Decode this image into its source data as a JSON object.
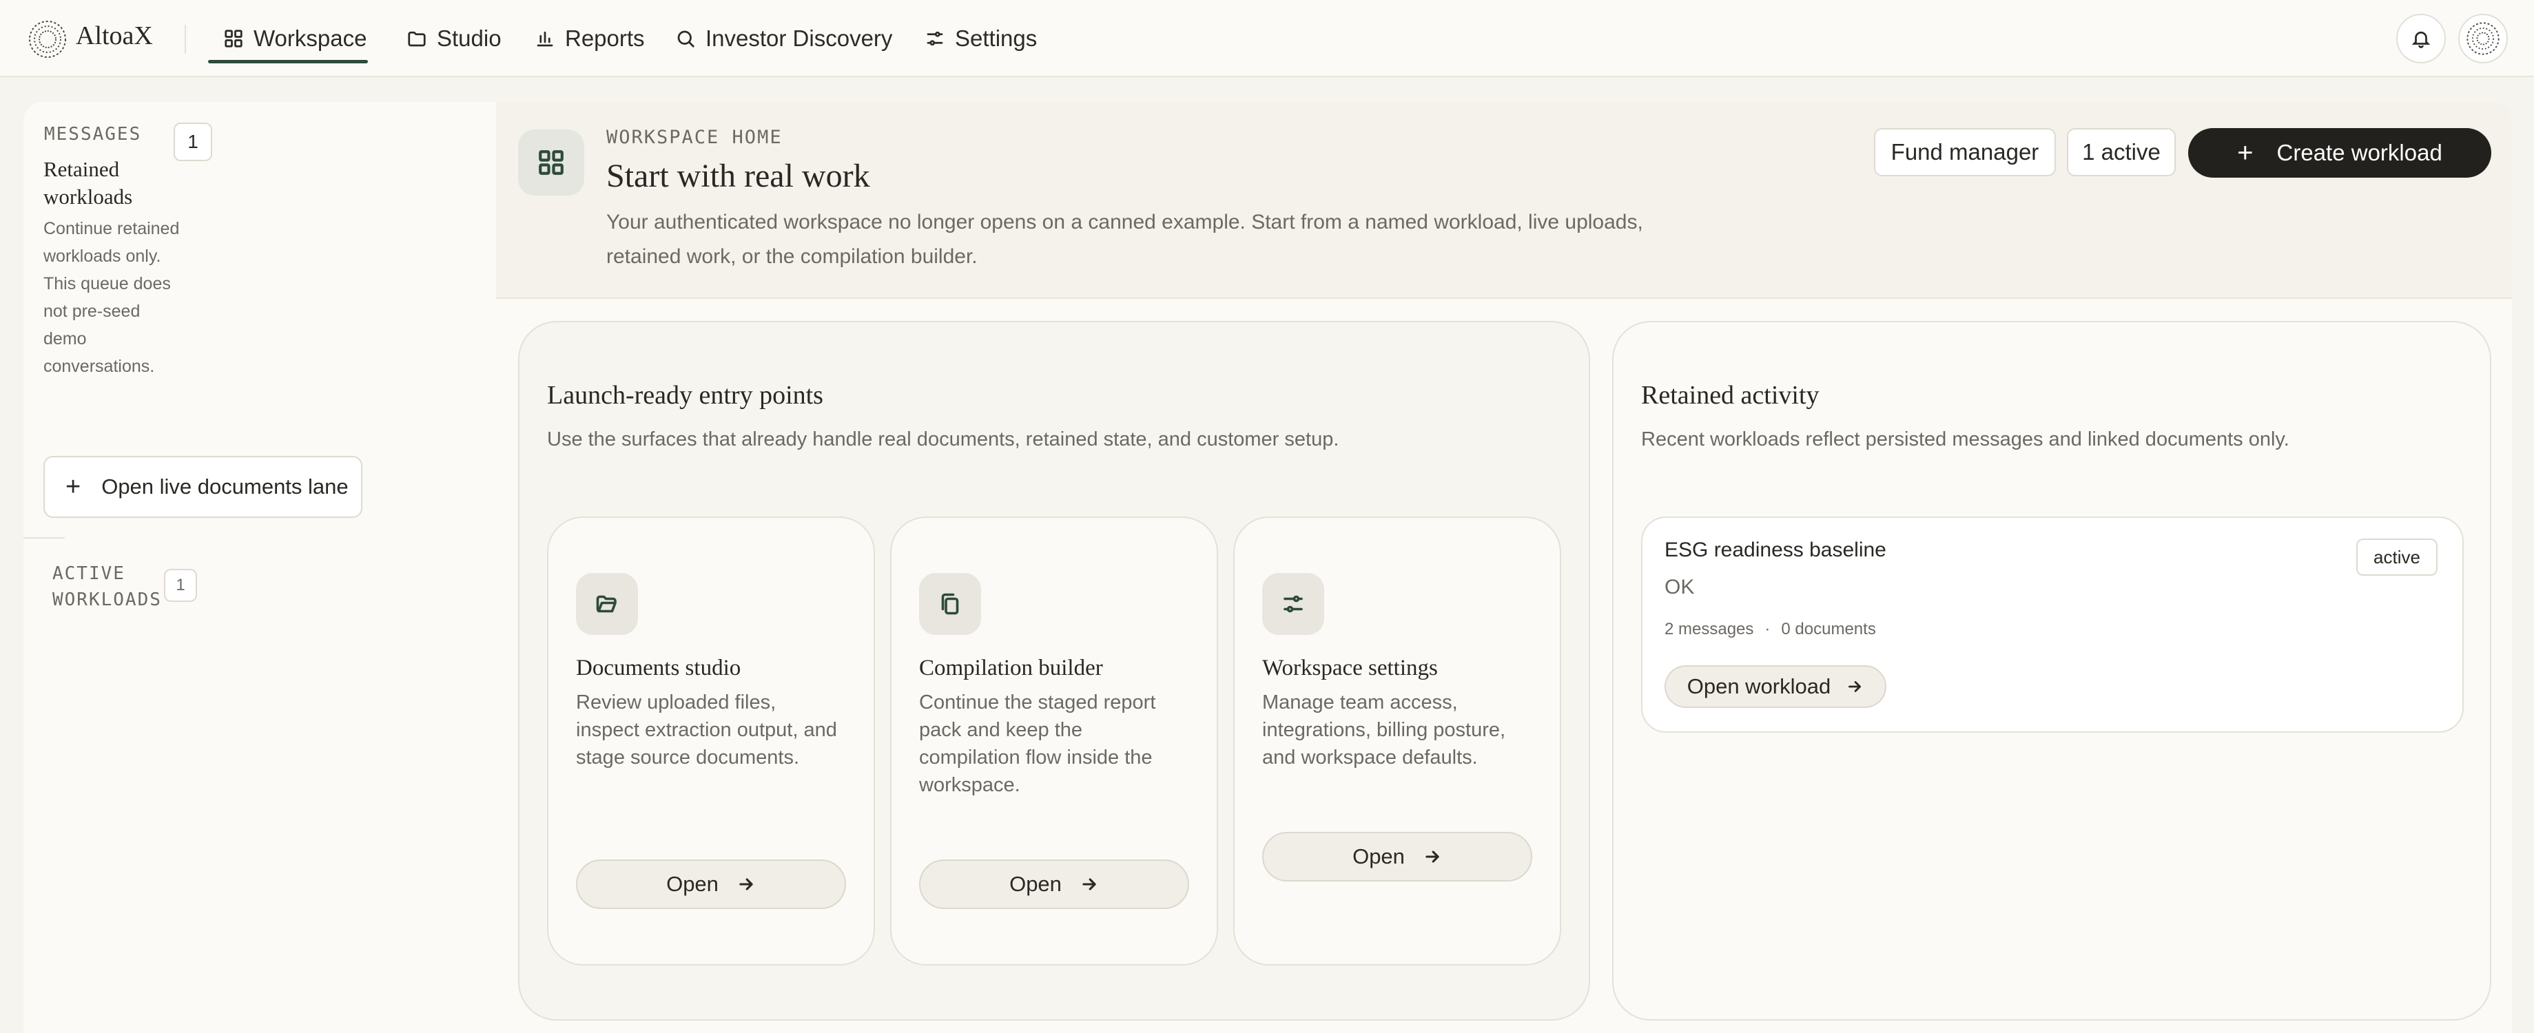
{
  "app": {
    "brand": "AltoaX"
  },
  "nav": [
    {
      "label": "Workspace",
      "icon": "grid-icon",
      "active": true
    },
    {
      "label": "Studio",
      "icon": "folder-icon"
    },
    {
      "label": "Reports",
      "icon": "bar-chart-icon"
    },
    {
      "label": "Investor Discovery",
      "icon": "search-icon"
    },
    {
      "label": "Settings",
      "icon": "sliders-icon"
    }
  ],
  "sidebar": {
    "messages_heading": "MESSAGES",
    "messages_count": "1",
    "section_title": "Retained workloads",
    "section_desc": "Continue retained workloads only. This queue does not pre-seed demo conversations.",
    "open_button": "Open live documents lane",
    "active_heading": "ACTIVE WORKLOADS",
    "active_count": "1"
  },
  "hero": {
    "eyebrow": "WORKSPACE HOME",
    "title": "Start with real work",
    "description": "Your authenticated workspace no longer opens on a canned example. Start from a named workload, live uploads, retained work, or the compilation builder.",
    "role_chip": "Fund manager",
    "active_chip": "1 active",
    "create_button": "Create workload"
  },
  "entry_points": {
    "title": "Launch-ready entry points",
    "description": "Use the surfaces that already handle real documents, retained state, and customer setup.",
    "cards": [
      {
        "title": "Documents studio",
        "description": "Review uploaded files, inspect extraction output, and stage source documents.",
        "button": "Open",
        "icon": "folder-open-icon"
      },
      {
        "title": "Compilation builder",
        "description": "Continue the staged report pack and keep the compilation flow inside the workspace.",
        "button": "Open",
        "icon": "copy-icon"
      },
      {
        "title": "Workspace settings",
        "description": "Manage team access, integrations, billing posture, and workspace defaults.",
        "button": "Open",
        "icon": "settings-sliders-icon"
      }
    ]
  },
  "activity": {
    "title": "Retained activity",
    "description": "Recent workloads reflect persisted messages and linked documents only.",
    "workload": {
      "title": "ESG readiness baseline",
      "status": "OK",
      "messages": "2 messages",
      "separator": "·",
      "documents": "0 documents",
      "badge": "active",
      "button": "Open workload"
    }
  },
  "colors": {
    "accent": "#2e4a3a",
    "dark_button": "#23211d",
    "background": "#f6f4ee"
  }
}
